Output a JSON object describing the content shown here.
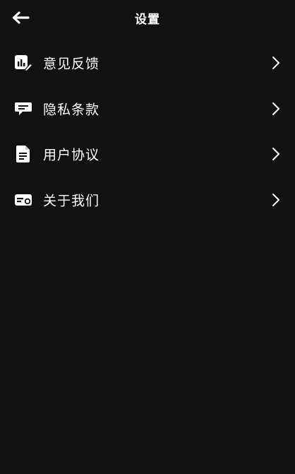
{
  "header": {
    "title": "设置",
    "back_icon": "back-arrow-icon"
  },
  "menu": {
    "items": [
      {
        "label": "意见反馈",
        "icon": "feedback-edit-icon"
      },
      {
        "label": "隐私条款",
        "icon": "chat-bubble-icon"
      },
      {
        "label": "用户协议",
        "icon": "document-icon"
      },
      {
        "label": "关于我们",
        "icon": "id-card-icon"
      }
    ]
  },
  "colors": {
    "background": "#111111",
    "text": "#ffffff"
  }
}
